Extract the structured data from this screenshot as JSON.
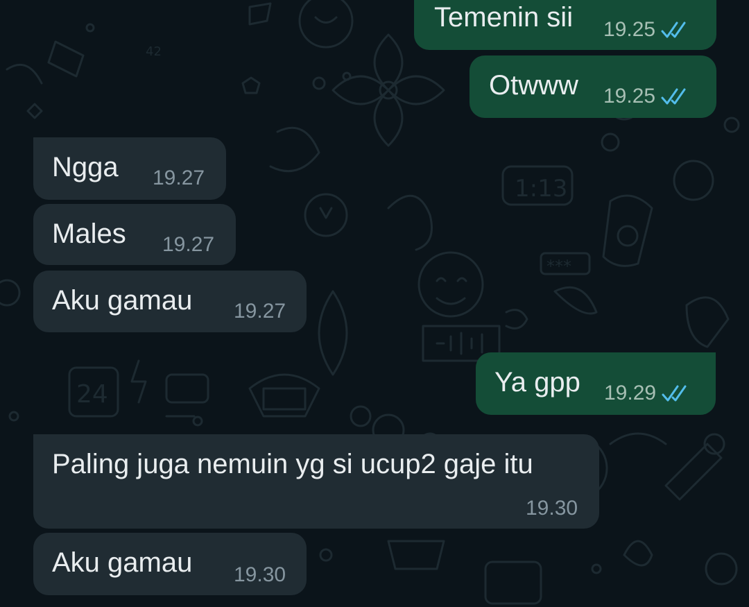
{
  "colors": {
    "background": "#0b141a",
    "incoming_bubble": "#202c33",
    "outgoing_bubble": "#144d37",
    "read_ticks": "#53bdeb",
    "timestamp": "#8696a0",
    "message_text": "#e9edef"
  },
  "icons": {
    "read_receipt": "double-check-icon"
  },
  "messages": [
    {
      "direction": "outgoing",
      "text": "Temenin sii",
      "time": "19.25",
      "status": "read"
    },
    {
      "direction": "outgoing",
      "text": "Otwww",
      "time": "19.25",
      "status": "read"
    },
    {
      "direction": "incoming",
      "text": "Ngga",
      "time": "19.27"
    },
    {
      "direction": "incoming",
      "text": "Males",
      "time": "19.27"
    },
    {
      "direction": "incoming",
      "text": "Aku gamau",
      "time": "19.27"
    },
    {
      "direction": "outgoing",
      "text": "Ya gpp",
      "time": "19.29",
      "status": "read"
    },
    {
      "direction": "incoming",
      "text": "Paling juga nemuin yg si ucup2 gaje itu",
      "time": "19.30"
    },
    {
      "direction": "incoming",
      "text": "Aku gamau",
      "time": "19.30"
    }
  ]
}
